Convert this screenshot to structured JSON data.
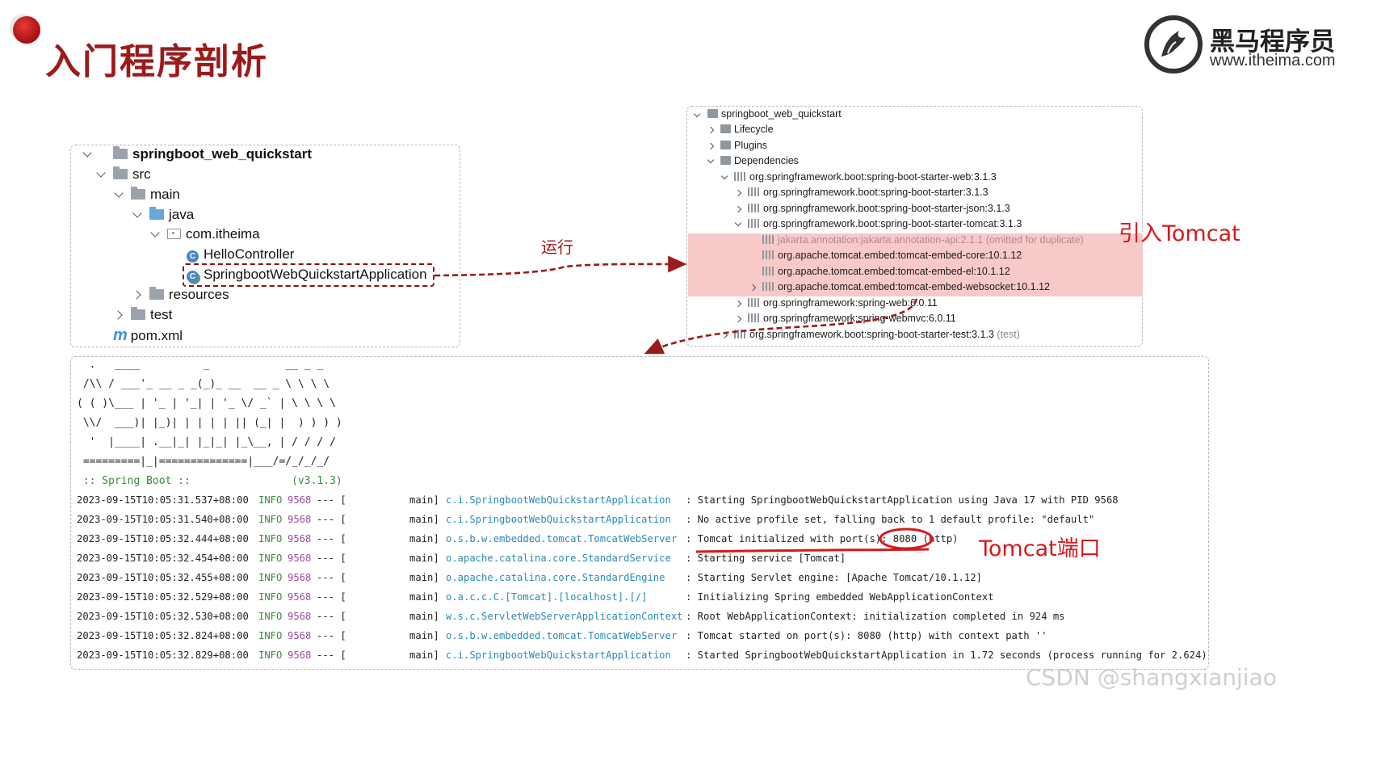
{
  "header": {
    "title": "入门程序剖析",
    "logo_cn": "黑马程序员",
    "logo_url": "www.itheima.com"
  },
  "project_tree": {
    "root": "springboot_web_quickstart",
    "src": "src",
    "main": "main",
    "java": "java",
    "package": "com.itheima",
    "class_1": "HelloController",
    "class_2": "SpringbootWebQuickstartApplication",
    "resources": "resources",
    "test": "test",
    "pom": "pom.xml"
  },
  "run_label": "运行",
  "maven_tree": {
    "root": "springboot_web_quickstart",
    "lifecycle": "Lifecycle",
    "plugins": "Plugins",
    "dependencies": "Dependencies",
    "dep_web": "org.springframework.boot:spring-boot-starter-web:3.1.3",
    "dep_starter": "org.springframework.boot:spring-boot-starter:3.1.3",
    "dep_json": "org.springframework.boot:spring-boot-starter-json:3.1.3",
    "dep_tomcat": "org.springframework.boot:spring-boot-starter-tomcat:3.1.3",
    "dep_jakarta": "jakarta.annotation:jakarta.annotation-api:2.1.1 (omitted for duplicate)",
    "dep_core": "org.apache.tomcat.embed:tomcat-embed-core:10.1.12",
    "dep_el": "org.apache.tomcat.embed:tomcat-embed-el:10.1.12",
    "dep_ws": "org.apache.tomcat.embed:tomcat-embed-websocket:10.1.12",
    "dep_spring_web": "org.springframework:spring-web:6.0.11",
    "dep_webmvc": "org.springframework:spring-webmvc:6.0.11",
    "dep_test": "org.springframework.boot:spring-boot-starter-test:3.1.3",
    "dep_test_scope": "(test)"
  },
  "annotations": {
    "tomcat_intro": "引入Tomcat",
    "tomcat_port": "Tomcat端口"
  },
  "console": {
    "banner": [
      "  .   ____          _            __ _ _",
      " /\\\\ / ___'_ __ _ _(_)_ __  __ _ \\ \\ \\ \\",
      "( ( )\\___ | '_ | '_| | '_ \\/ _` | \\ \\ \\ \\",
      " \\\\/  ___)| |_)| | | | | || (_| |  ) ) ) )",
      "  '  |____| .__|_| |_|_| |_\\__, | / / / /",
      " =========|_|==============|___/=/_/_/_/",
      " :: Spring Boot ::                (v3.1.3)"
    ],
    "logs": [
      {
        "ts": "2023-09-15T10:05:31.537+08:00",
        "level": "INFO",
        "pid": "9568",
        "sep": "--- [",
        "thread": "main]",
        "logger": "c.i.SpringbootWebQuickstartApplication",
        "msg": ": Starting SpringbootWebQuickstartApplication using Java 17 with PID 9568"
      },
      {
        "ts": "2023-09-15T10:05:31.540+08:00",
        "level": "INFO",
        "pid": "9568",
        "sep": "--- [",
        "thread": "main]",
        "logger": "c.i.SpringbootWebQuickstartApplication",
        "msg": ": No active profile set, falling back to 1 default profile: \"default\""
      },
      {
        "ts": "2023-09-15T10:05:32.444+08:00",
        "level": "INFO",
        "pid": "9568",
        "sep": "--- [",
        "thread": "main]",
        "logger": "o.s.b.w.embedded.tomcat.TomcatWebServer",
        "msg": ": Tomcat initialized with port(s): 8080 (http)"
      },
      {
        "ts": "2023-09-15T10:05:32.454+08:00",
        "level": "INFO",
        "pid": "9568",
        "sep": "--- [",
        "thread": "main]",
        "logger": "o.apache.catalina.core.StandardService",
        "msg": ": Starting service [Tomcat]"
      },
      {
        "ts": "2023-09-15T10:05:32.455+08:00",
        "level": "INFO",
        "pid": "9568",
        "sep": "--- [",
        "thread": "main]",
        "logger": "o.apache.catalina.core.StandardEngine",
        "msg": ": Starting Servlet engine: [Apache Tomcat/10.1.12]"
      },
      {
        "ts": "2023-09-15T10:05:32.529+08:00",
        "level": "INFO",
        "pid": "9568",
        "sep": "--- [",
        "thread": "main]",
        "logger": "o.a.c.c.C.[Tomcat].[localhost].[/]",
        "msg": ": Initializing Spring embedded WebApplicationContext"
      },
      {
        "ts": "2023-09-15T10:05:32.530+08:00",
        "level": "INFO",
        "pid": "9568",
        "sep": "--- [",
        "thread": "main]",
        "logger": "w.s.c.ServletWebServerApplicationContext",
        "msg": ": Root WebApplicationContext: initialization completed in 924 ms"
      },
      {
        "ts": "2023-09-15T10:05:32.824+08:00",
        "level": "INFO",
        "pid": "9568",
        "sep": "--- [",
        "thread": "main]",
        "logger": "o.s.b.w.embedded.tomcat.TomcatWebServer",
        "msg": ": Tomcat started on port(s): 8080 (http) with context path ''"
      },
      {
        "ts": "2023-09-15T10:05:32.829+08:00",
        "level": "INFO",
        "pid": "9568",
        "sep": "--- [",
        "thread": "main]",
        "logger": "c.i.SpringbootWebQuickstartApplication",
        "msg": ": Started SpringbootWebQuickstartApplication in 1.72 seconds (process running for 2.624)"
      }
    ]
  },
  "watermark": "CSDN @shangxianjiao",
  "colors": {
    "title": "#9c1a1a",
    "annotation": "#d51a1a",
    "highlight_band": "#f8c9c9",
    "arrow": "#9c1a1a"
  }
}
